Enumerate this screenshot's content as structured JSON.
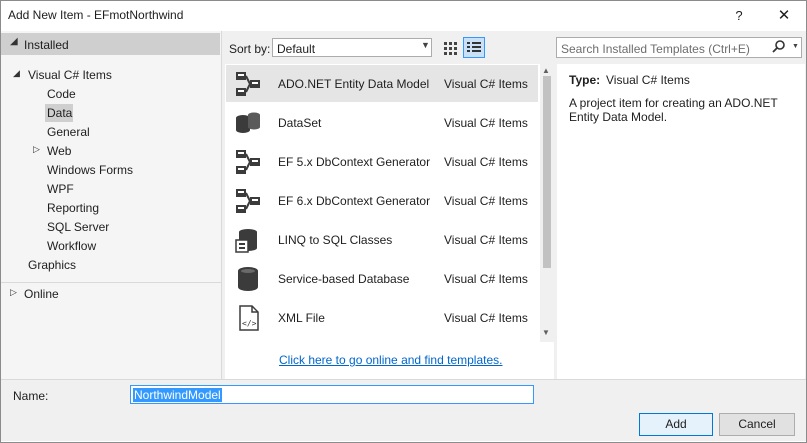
{
  "window": {
    "title": "Add New Item - EFmotNorthwind",
    "help_label": "?",
    "close_label": "✕"
  },
  "tree": {
    "installed": "Installed",
    "visual_cs_items": "Visual C# Items",
    "code": "Code",
    "data": "Data",
    "general": "General",
    "web": "Web",
    "windows_forms": "Windows Forms",
    "wpf": "WPF",
    "reporting": "Reporting",
    "sql_server": "SQL Server",
    "workflow": "Workflow",
    "graphics": "Graphics",
    "online": "Online"
  },
  "toolbar": {
    "sort_by_label": "Sort by:",
    "sort_value": "Default",
    "search_placeholder": "Search Installed Templates (Ctrl+E)"
  },
  "templates": [
    {
      "name": "ADO.NET Entity Data Model",
      "category": "Visual C# Items",
      "icon": "entity-model-icon",
      "selected": true
    },
    {
      "name": "DataSet",
      "category": "Visual C# Items",
      "icon": "dataset-icon"
    },
    {
      "name": "EF 5.x DbContext Generator",
      "category": "Visual C# Items",
      "icon": "entity-model-icon"
    },
    {
      "name": "EF 6.x DbContext Generator",
      "category": "Visual C# Items",
      "icon": "entity-model-icon"
    },
    {
      "name": "LINQ to SQL Classes",
      "category": "Visual C# Items",
      "icon": "linq-classes-icon"
    },
    {
      "name": "Service-based Database",
      "category": "Visual C# Items",
      "icon": "database-icon"
    },
    {
      "name": "XML File",
      "category": "Visual C# Items",
      "icon": "xml-file-icon"
    }
  ],
  "online_link": "Click here to go online and find templates.",
  "details": {
    "type_label": "Type:",
    "type_value": "Visual C# Items",
    "description": "A project item for creating an ADO.NET Entity Data Model."
  },
  "footer": {
    "name_label": "Name:",
    "name_value": "NorthwindModel",
    "add_label": "Add",
    "cancel_label": "Cancel"
  }
}
